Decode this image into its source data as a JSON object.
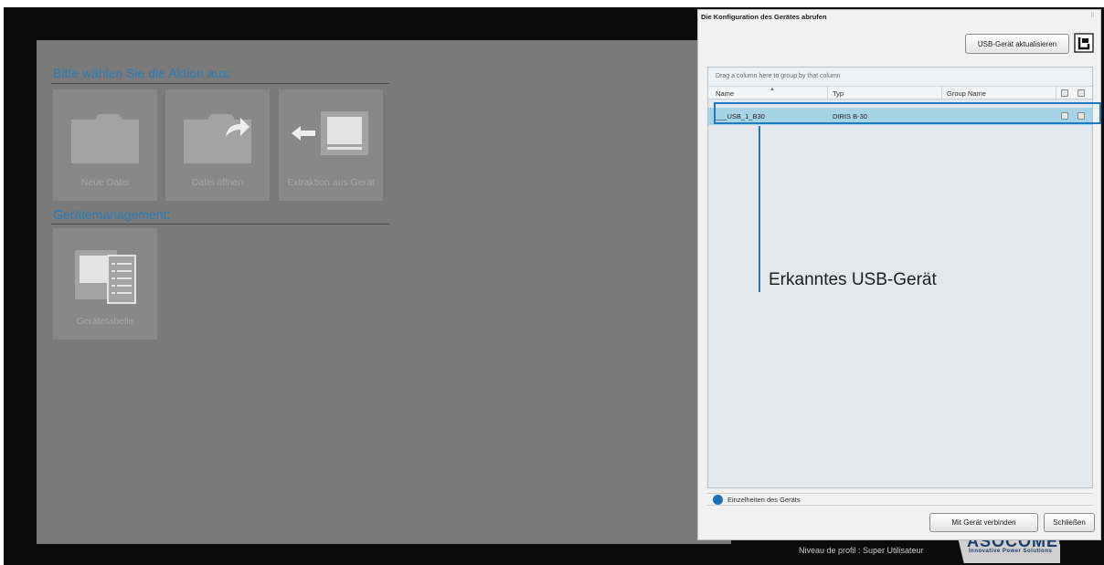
{
  "app": {
    "section_action": "Bitte wählen Sie die Aktion aus:",
    "section_management": "Gerätemanagement:",
    "tiles": [
      {
        "label": "Neue Datei",
        "icon": "folder-icon"
      },
      {
        "label": "Datei öffnen",
        "icon": "folder-open-arrow-icon"
      },
      {
        "label": "Extraktion aus Gerät",
        "icon": "device-extract-icon"
      },
      {
        "label": "Gerätetabelle",
        "icon": "device-table-icon"
      }
    ],
    "status": "Niveau de profil : Super Utilisateur",
    "brand": {
      "name": "ASOCOMEC",
      "slogan": "Innovative Power Solutions"
    }
  },
  "dialog": {
    "title": "Die Konfiguration des Gerätes abrufen",
    "refresh_button": "USB-Gerät aktualisieren",
    "group_hint": "Drag a column here to group by that column",
    "columns": [
      "Name",
      "Typ",
      "Group Name"
    ],
    "rows": [
      {
        "name": "___USB_1_B30",
        "type": "DIRIS B-30",
        "group": ""
      }
    ],
    "details_label": "Einzelheiten des Geräts",
    "connect_button": "Mit Gerät verbinden",
    "close_button": "Schließen"
  },
  "callout": "Erkanntes USB-Gerät",
  "colors": {
    "accent": "#1f7abf",
    "section_title": "#2a7db8",
    "row_selected": "#a7d3e6",
    "background_dark": "#0b0b0b",
    "panel_gray": "#7a7a7a"
  }
}
